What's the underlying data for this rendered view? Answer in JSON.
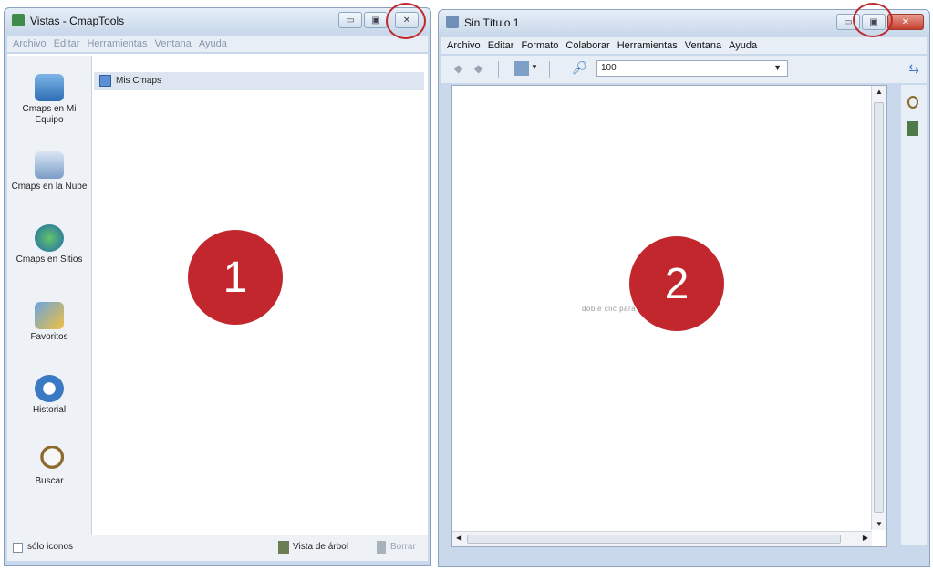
{
  "left_window": {
    "title": "Vistas - CmapTools",
    "menu": [
      "Archivo",
      "Editar",
      "Herramientas",
      "Ventana",
      "Ayuda"
    ],
    "tree_item": "Mis Cmaps",
    "sidebar": [
      {
        "label": "Cmaps en Mi Equipo",
        "icon": "computer-icon"
      },
      {
        "label": "Cmaps en la Nube",
        "icon": "cloud-network-icon"
      },
      {
        "label": "Cmaps en Sitios",
        "icon": "globe-icon"
      },
      {
        "label": "Favoritos",
        "icon": "favorites-icon"
      },
      {
        "label": "Historial",
        "icon": "history-icon"
      },
      {
        "label": "Buscar",
        "icon": "search-magnifier-icon"
      }
    ],
    "status": {
      "only_icons": "sólo iconos",
      "tree_view": "Vista de árbol",
      "delete": "Borrar"
    },
    "marker": "1"
  },
  "right_window": {
    "title": "Sin Título 1",
    "menu": [
      "Archivo",
      "Editar",
      "Formato",
      "Colaborar",
      "Herramientas",
      "Ventana",
      "Ayuda"
    ],
    "zoom": "100",
    "canvas_hint": "doble clic para crear un concepto",
    "marker": "2"
  },
  "colors": {
    "marker": "#c1272d",
    "ring": "#c0282d",
    "window_frame": "#c9d8ea"
  }
}
